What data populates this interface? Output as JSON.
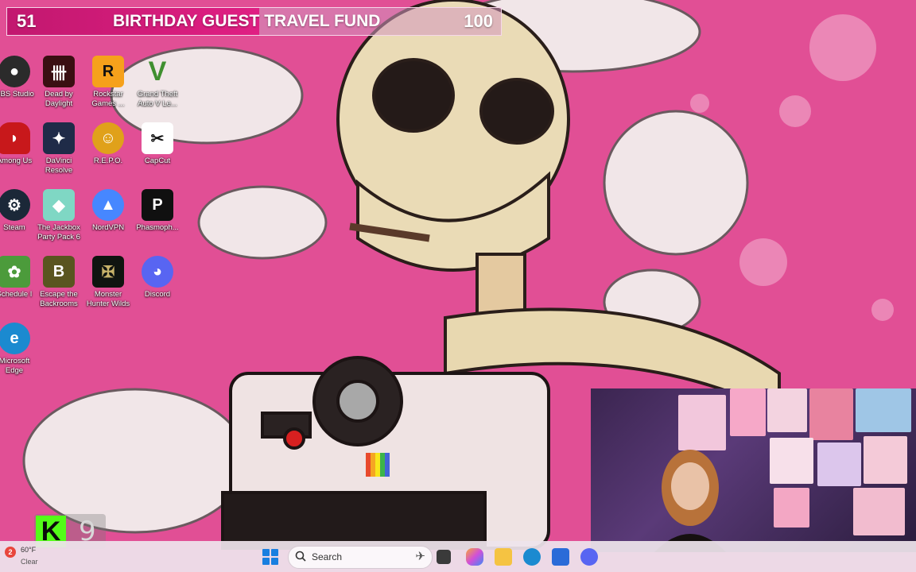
{
  "goal": {
    "current": "51",
    "title": "BIRTHDAY GUEST TRAVEL FUND",
    "target": "100",
    "progress_percent": 51,
    "fill_color": "#e01f83"
  },
  "desktop_icons": [
    {
      "label": "OBS Studio",
      "icon": "obs-icon",
      "color": "#2b2b2b"
    },
    {
      "label": "Dead by\nDaylight",
      "icon": "dead-by-daylight-icon",
      "color": "#3a0f12"
    },
    {
      "label": "Rockstar\nGames ...",
      "icon": "rockstar-icon",
      "color": "#f6a11b"
    },
    {
      "label": "Grand Theft\nAuto V Le...",
      "icon": "gta-v-icon",
      "color": "#2f6d2a"
    },
    {
      "label": "Among Us",
      "icon": "among-us-icon",
      "color": "#c8181b"
    },
    {
      "label": "DaVinci\nResolve",
      "icon": "davinci-resolve-icon",
      "color": "#1f2b48"
    },
    {
      "label": "R.E.P.O.",
      "icon": "repo-icon",
      "color": "#e0a11a"
    },
    {
      "label": "CapCut",
      "icon": "capcut-icon",
      "color": "#ffffff"
    },
    {
      "label": "Steam",
      "icon": "steam-icon",
      "color": "#1b2838"
    },
    {
      "label": "The Jackbox\nParty Pack 6",
      "icon": "jackbox-icon",
      "color": "#7fd7c4"
    },
    {
      "label": "NordVPN",
      "icon": "nordvpn-icon",
      "color": "#4687ff"
    },
    {
      "label": "Phasmoph...",
      "icon": "phasmophobia-icon",
      "color": "#101010"
    },
    {
      "label": "Schedule I",
      "icon": "schedule-i-icon",
      "color": "#4c9b3b"
    },
    {
      "label": "Escape the\nBackrooms",
      "icon": "escape-backrooms-icon",
      "color": "#5a5520"
    },
    {
      "label": "Monster\nHunter Wilds",
      "icon": "monster-hunter-icon",
      "color": "#0f1410"
    },
    {
      "label": "Discord",
      "icon": "discord-icon",
      "color": "#5865f2"
    },
    {
      "label": "Microsoft\nEdge",
      "icon": "edge-icon",
      "color": "#1b8ad0"
    }
  ],
  "kick": {
    "letter": "K",
    "count": "9"
  },
  "taskbar": {
    "weather_temp": "60°F",
    "weather_cond": "Clear",
    "search_placeholder": "Search",
    "apps": [
      "task-view-icon",
      "copilot-icon",
      "file-explorer-icon",
      "edge-icon",
      "store-icon",
      "discord-icon"
    ]
  }
}
